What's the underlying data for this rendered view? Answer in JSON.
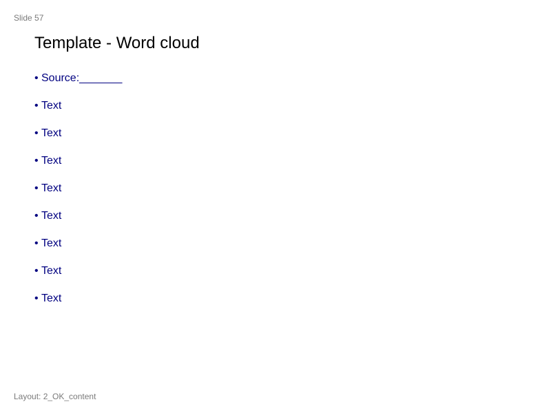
{
  "slide": {
    "number_label": "Slide 57",
    "title": "Template - Word cloud",
    "bullet_glyph": "•",
    "bullets": [
      "Source:_______",
      "Text",
      "Text",
      "Text",
      "Text",
      "Text",
      "Text",
      "Text",
      "Text"
    ],
    "layout_label": "Layout: 2_OK_content"
  },
  "colors": {
    "bullet_text": "#000080",
    "meta_text": "#7a7a7a",
    "title_text": "#000000"
  }
}
